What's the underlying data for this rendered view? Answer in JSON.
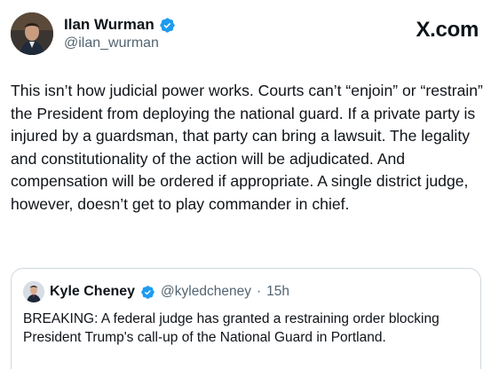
{
  "post": {
    "author_name": "Ilan Wurman",
    "author_handle": "@ilan_wurman",
    "verified_icon": "verified-badge-icon",
    "brand_label": "X.com",
    "text": "This isn’t how judicial power works. Courts can’t “enjoin” or “restrain” the President from deploying the national guard. If a private party is injured by a guardsman, that party can bring a lawsuit. The legality and constitutionality of the action will be adjudicated. And compensation will be ordered if appropriate. A single district judge, however, doesn’t get to play commander in chief."
  },
  "quoted_post": {
    "author_name": "Kyle Cheney",
    "author_handle": "@kyledcheney",
    "separator": "·",
    "timestamp": "15h",
    "text": "BREAKING:  A federal judge has granted a restraining order blocking President Trump's call-up of the National Guard in Portland."
  },
  "colors": {
    "text_primary": "#0f1419",
    "text_secondary": "#536471",
    "verified_blue": "#1d9bf0",
    "border": "#cfd9de"
  }
}
